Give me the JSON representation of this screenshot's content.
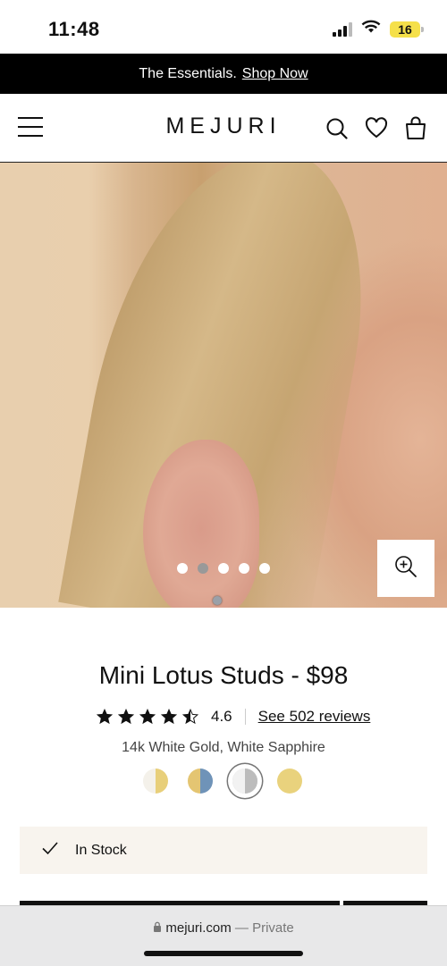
{
  "status": {
    "time": "11:48",
    "battery": "16"
  },
  "promo": {
    "text": "The Essentials.",
    "link": "Shop Now"
  },
  "nav": {
    "logo": "MEJURI"
  },
  "product": {
    "title": "Mini Lotus Studs - $98",
    "rating": "4.6",
    "stars_filled": 4.5,
    "reviews_link": "See 502 reviews",
    "variant": "14k White Gold, White Sapphire",
    "stock": "In Stock"
  },
  "carousel": {
    "count": 5,
    "active_index": 1
  },
  "swatches": [
    {
      "left": "#f4f1ea",
      "right": "#e8cf7a"
    },
    {
      "left": "#e4c572",
      "right": "#6f93b8"
    },
    {
      "left": "#f2f2f2",
      "right": "#bcbcbc",
      "selected": true
    },
    {
      "left": "#e9d27d",
      "right": "#e9d27d"
    }
  ],
  "browser": {
    "domain": "mejuri.com",
    "mode": "Private",
    "separator": "—"
  },
  "colors": {
    "promo_bg": "#000000",
    "stock_bg": "#f8f4ee",
    "battery": "#f5e04a"
  },
  "icons": [
    "hamburger-icon",
    "search-icon",
    "heart-icon",
    "bag-icon",
    "zoom-icon",
    "check-icon",
    "star-icon",
    "lock-icon",
    "wifi-icon",
    "signal-icon"
  ]
}
